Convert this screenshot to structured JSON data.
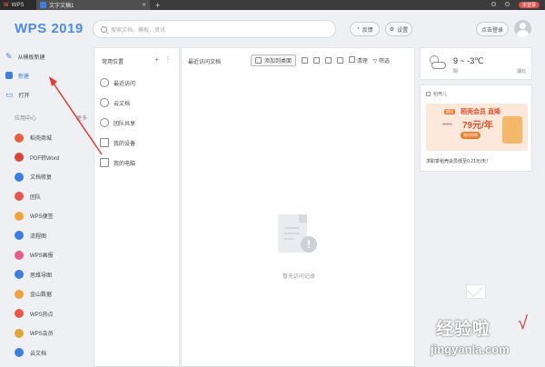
{
  "titlebar": {
    "wps_tab": "WPS",
    "doc_tab": "文字文稿1",
    "right_items": [
      "",
      ""
    ],
    "user_badge": "未登录"
  },
  "header": {
    "app_title": "WPS 2019",
    "search_placeholder": "搜索文档、模板、资讯",
    "feedback_label": "反馈",
    "settings_label": "设置",
    "login_label": "点击登录"
  },
  "sidebar": {
    "top_items": [
      {
        "label": "从模板新建"
      },
      {
        "label": "新建"
      },
      {
        "label": "打开"
      }
    ],
    "section_label": "应用中心",
    "section_more": "更多",
    "apps": [
      {
        "label": "稻壳商城",
        "color": "#e8603c"
      },
      {
        "label": "PDF转Word",
        "color": "#d9443a"
      },
      {
        "label": "文档修复",
        "color": "#3d7fe0"
      },
      {
        "label": "团队",
        "color": "#e9564a"
      },
      {
        "label": "WPS便签",
        "color": "#f2a23a"
      },
      {
        "label": "流程图",
        "color": "#3d7fe0"
      },
      {
        "label": "WPS画报",
        "color": "#e85c8a"
      },
      {
        "label": "思维导图",
        "color": "#3d7fe0"
      },
      {
        "label": "金山数据",
        "color": "#f2a23a"
      },
      {
        "label": "WPS热点",
        "color": "#e9564a"
      },
      {
        "label": "WPS会员",
        "color": "#e0a43a"
      },
      {
        "label": "云文档",
        "color": "#3d7fe0"
      }
    ]
  },
  "locations": {
    "title": "常用位置",
    "items": [
      {
        "label": "最近访问"
      },
      {
        "label": "云文档"
      },
      {
        "label": "团队共享"
      },
      {
        "label": "我的设备"
      },
      {
        "label": "我的电脑"
      }
    ]
  },
  "recent": {
    "title": "最近访问文档",
    "add_desktop": "添加到桌面",
    "filter_label": "筛选",
    "clear_label": "清理",
    "empty_text": "暂无访问记录"
  },
  "weather": {
    "temp": "9 ~ -3℃",
    "condition": "阴",
    "city": "湖北"
  },
  "ad": {
    "header": "稻壳儿",
    "tag": "超值",
    "headline": "稻壳会员 直降",
    "price": "79元/年",
    "old_price": "199元",
    "cta": "限时抢购",
    "caption": "求职季稻壳会员低至0.21元/天！"
  },
  "watermark": {
    "cn": "经验啦",
    "check": "√",
    "url": "jingyanla.com"
  },
  "colors": {
    "accent": "#3d7fe0",
    "arrow": "#e53935"
  }
}
